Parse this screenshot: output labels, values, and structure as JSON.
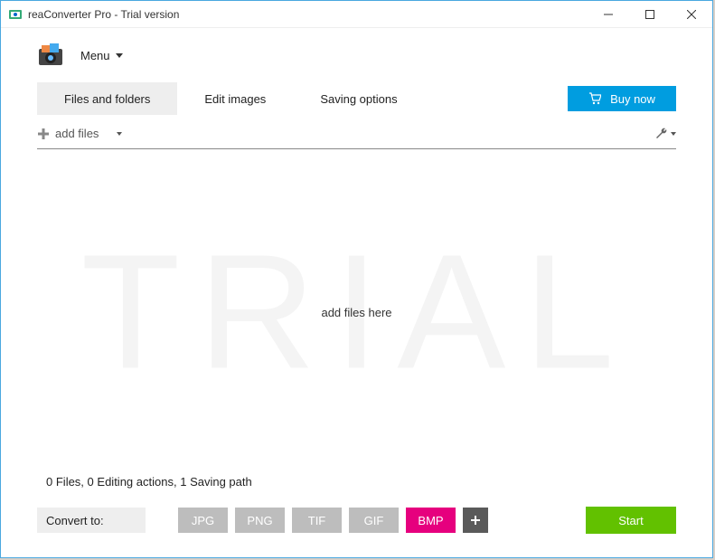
{
  "window": {
    "title": "reaConverter Pro - Trial version"
  },
  "menu": {
    "label": "Menu"
  },
  "tabs": {
    "files_folders": "Files and folders",
    "edit_images": "Edit images",
    "saving_options": "Saving options"
  },
  "buy": {
    "label": "Buy now"
  },
  "toolbar": {
    "add_files": "add files"
  },
  "drop": {
    "hint": "add files here",
    "watermark": "TRIAL"
  },
  "status": {
    "files_count": "0",
    "files_label": "Files,",
    "actions_count": "0",
    "actions_label": "Editing actions,",
    "paths_count": "1",
    "paths_label": "Saving path"
  },
  "convert": {
    "label": "Convert to:",
    "formats": {
      "jpg": "JPG",
      "png": "PNG",
      "tif": "TIF",
      "gif": "GIF",
      "bmp": "BMP"
    },
    "start": "Start"
  }
}
